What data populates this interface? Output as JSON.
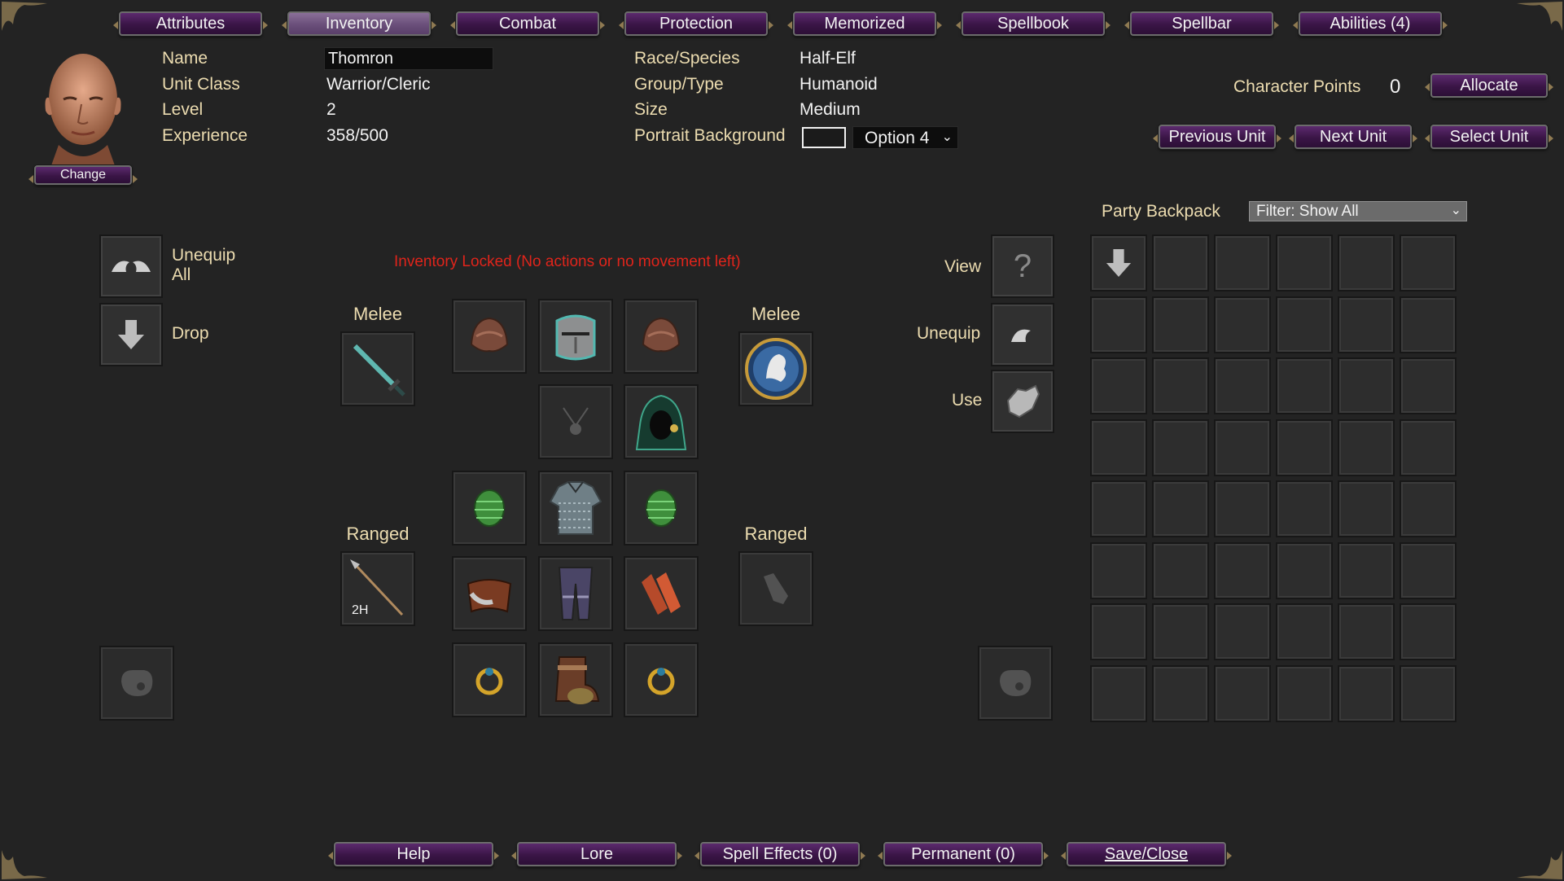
{
  "tabs": [
    {
      "label": "Attributes",
      "active": false
    },
    {
      "label": "Inventory",
      "active": true
    },
    {
      "label": "Combat",
      "active": false
    },
    {
      "label": "Protection",
      "active": false
    },
    {
      "label": "Memorized",
      "active": false
    },
    {
      "label": "Spellbook",
      "active": false
    },
    {
      "label": "Spellbar",
      "active": false
    },
    {
      "label": "Abilities (4)",
      "active": false
    }
  ],
  "portrait": {
    "change_label": "Change"
  },
  "unit": {
    "name_label": "Name",
    "name_value": "Thomron",
    "class_label": "Unit Class",
    "class_value": "Warrior/Cleric",
    "level_label": "Level",
    "level_value": "2",
    "experience_label": "Experience",
    "experience_value": "358/500",
    "race_label": "Race/Species",
    "race_value": "Half-Elf",
    "group_label": "Group/Type",
    "group_value": "Humanoid",
    "size_label": "Size",
    "size_value": "Medium",
    "portrait_bg_label": "Portrait Background",
    "portrait_bg_value": "Option 4"
  },
  "character_points": {
    "label": "Character Points",
    "value": "0",
    "allocate_label": "Allocate"
  },
  "unit_nav": {
    "previous": "Previous Unit",
    "next": "Next Unit",
    "select": "Select Unit"
  },
  "left_actions": {
    "unequip_all": "Unequip All",
    "drop": "Drop"
  },
  "status_message": "Inventory Locked (No actions or no movement left)",
  "equipment": {
    "melee_left": "Melee",
    "melee_right": "Melee",
    "ranged_left": "Ranged",
    "ranged_right": "Ranged",
    "two_handed_badge": "2H"
  },
  "right_actions": {
    "view": "View",
    "unequip": "Unequip",
    "use": "Use"
  },
  "backpack": {
    "label": "Party Backpack",
    "filter": "Filter: Show All",
    "rows": 8,
    "cols": 6
  },
  "bottom_buttons": {
    "help": "Help",
    "lore": "Lore",
    "spell_effects": "Spell Effects (0)",
    "permanent": "Permanent (0)",
    "save_close": "Save/Close"
  },
  "colors": {
    "accent_purple": "#3a1546",
    "warning_red": "#e0241b",
    "label_tan": "#ecdcb0"
  }
}
